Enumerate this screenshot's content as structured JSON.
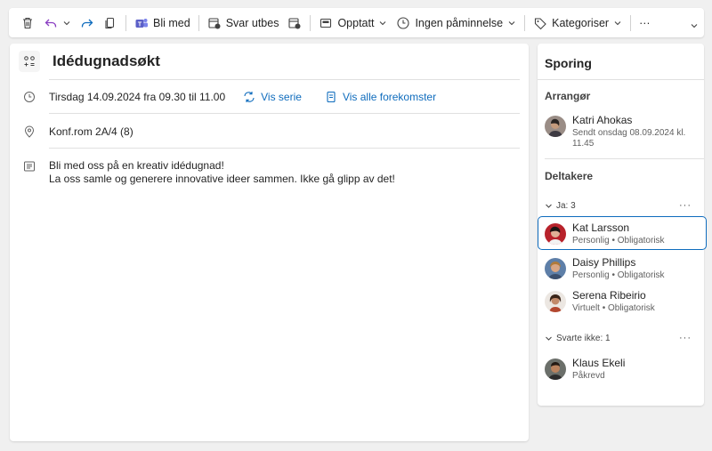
{
  "toolbar": {
    "join_label": "Bli med",
    "reply_label": "Svar utbes",
    "busy_label": "Opptatt",
    "reminder_label": "Ingen påminnelse",
    "categorize_label": "Kategoriser",
    "more_label": "···"
  },
  "event": {
    "title": "Idédugnadsøkt",
    "datetime": "Tirsdag 14.09.2024 fra 09.30 til 11.00",
    "series_link": "Vis serie",
    "occurrences_link": "Vis alle forekomster",
    "location": "Konf.rom 2A/4 (8)",
    "description_line1": "Bli med oss på en kreativ idédugnad!",
    "description_line2": "La oss samle og generere innovative ideer sammen. Ikke gå glipp av det!"
  },
  "tracking": {
    "title": "Sporing",
    "organizer_label": "Arrangør",
    "organizer": {
      "name": "Katri Ahokas",
      "sent_line1": "Sendt onsdag 08.09.2024 kl.",
      "sent_line2": "11.45"
    },
    "attendees_label": "Deltakere",
    "yes_group": "Ja: 3",
    "no_reply_group": "Svarte ikke: 1",
    "more": "···",
    "yes": [
      {
        "name": "Kat Larsson",
        "detail": "Personlig • Obligatorisk"
      },
      {
        "name": "Daisy Phillips",
        "detail": "Personlig • Obligatorisk"
      },
      {
        "name": "Serena Ribeirio",
        "detail": "Virtuelt • Obligatorisk"
      }
    ],
    "no_reply": [
      {
        "name": "Klaus Ekeli",
        "detail": "Påkrevd"
      }
    ]
  },
  "colors": {
    "accent": "#0f6cbd",
    "teams": "#5b5fc7",
    "undo": "#8a3ec2"
  }
}
